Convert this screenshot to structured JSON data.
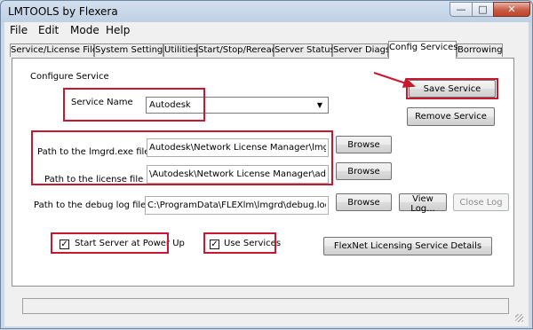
{
  "window": {
    "title": "LMTOOLS by Flexera"
  },
  "title_buttons": {
    "minimize": "—",
    "maximize": "□",
    "close": "✕"
  },
  "menu": [
    "File",
    "Edit",
    "Mode",
    "Help"
  ],
  "tabs": [
    "Service/License File",
    "System Settings",
    "Utilities",
    "Start/Stop/Reread",
    "Server Status",
    "Server Diags",
    "Config Services",
    "Borrowing"
  ],
  "active_tab": "Config Services",
  "config": {
    "section_label": "Configure Service",
    "service_name_label": "Service Name",
    "service_name_value": "Autodesk",
    "save_label": "Save Service",
    "remove_label": "Remove Service",
    "lmgrd_label": "Path to the lmgrd.exe file",
    "lmgrd_value": "Autodesk\\Network License Manager\\lmgrd.exe",
    "license_label": "Path to the license file",
    "license_value": "\\Autodesk\\Network License Manager\\adesk.lic",
    "debug_label": "Path to the debug log file",
    "debug_value": "C:\\ProgramData\\FLEXlm\\lmgrd\\debug.log",
    "browse_label": "Browse",
    "view_log_label": "View Log...",
    "close_log_label": "Close Log",
    "start_power_label": "Start Server at Power Up",
    "start_power_checked": true,
    "use_services_label": "Use Services",
    "use_services_checked": true,
    "details_label": "FlexNet Licensing Service Details",
    "check_mark": "✓"
  },
  "status_text": "",
  "colors": {
    "annotation": "#c8172f",
    "window_frame": "#c9d7e6"
  }
}
